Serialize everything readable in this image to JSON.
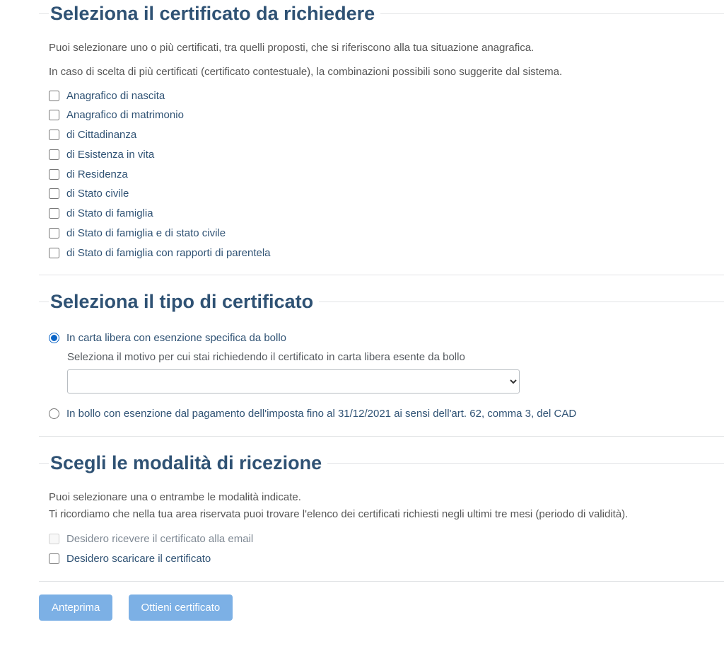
{
  "section1": {
    "legend": "Seleziona il certificato da richiedere",
    "intro1": "Puoi selezionare uno o più certificati, tra quelli proposti, che si riferiscono alla tua situazione anagrafica.",
    "intro2": "In caso di scelta di più certificati (certificato contestuale), la combinazioni possibili sono suggerite dal sistema.",
    "items": [
      {
        "label": "Anagrafico di nascita"
      },
      {
        "label": "Anagrafico di matrimonio"
      },
      {
        "label": "di Cittadinanza"
      },
      {
        "label": "di Esistenza in vita"
      },
      {
        "label": "di Residenza"
      },
      {
        "label": "di Stato civile"
      },
      {
        "label": "di Stato di famiglia"
      },
      {
        "label": "di Stato di famiglia e di stato civile"
      },
      {
        "label": "di Stato di famiglia con rapporti di parentela"
      }
    ]
  },
  "section2": {
    "legend": "Seleziona il tipo di certificato",
    "option1": {
      "label": "In carta libera con esenzione specifica da bollo",
      "subtext": "Seleziona il motivo per cui stai richiedendo il certificato in carta libera esente da bollo"
    },
    "option2": {
      "label": "In bollo con esenzione dal pagamento dell'imposta fino al 31/12/2021 ai sensi dell'art. 62, comma 3, del CAD"
    }
  },
  "section3": {
    "legend": "Scegli le modalità di ricezione",
    "intro1": "Puoi selezionare una o entrambe le modalità indicate.",
    "intro2": "Ti ricordiamo che nella tua area riservata puoi trovare l'elenco dei certificati richiesti negli ultimi tre mesi (periodo di validità).",
    "items": [
      {
        "label": "Desidero ricevere il certificato alla email",
        "disabled": true
      },
      {
        "label": "Desidero scaricare il certificato",
        "disabled": false
      }
    ]
  },
  "buttons": {
    "preview": "Anteprima",
    "obtain": "Ottieni certificato"
  }
}
